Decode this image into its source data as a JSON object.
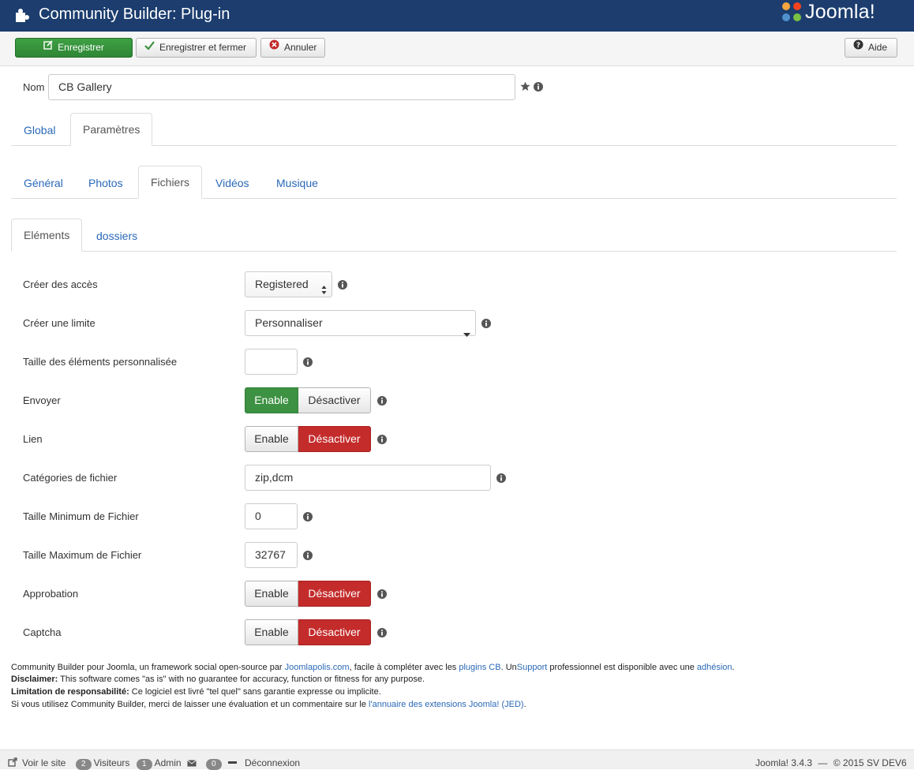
{
  "header": {
    "title": "Community Builder: Plug-in",
    "logo_text": "Joomla!"
  },
  "toolbar": {
    "save_label": "Enregistrer",
    "save_close_label": "Enregistrer et fermer",
    "cancel_label": "Annuler",
    "help_label": "Aide"
  },
  "name_field": {
    "label": "Nom",
    "value": "CB Gallery"
  },
  "main_tabs": [
    {
      "label": "Global",
      "active": false
    },
    {
      "label": "Paramètres",
      "active": true
    }
  ],
  "sub_tabs": [
    {
      "label": "Général",
      "active": false
    },
    {
      "label": "Photos",
      "active": false
    },
    {
      "label": "Fichiers",
      "active": true
    },
    {
      "label": "Vidéos",
      "active": false
    },
    {
      "label": "Musique",
      "active": false
    }
  ],
  "inner_tabs": [
    {
      "label": "Eléments",
      "active": true
    },
    {
      "label": "dossiers",
      "active": false
    }
  ],
  "fields": {
    "create_access": {
      "label": "Créer des accès",
      "value": "Registered"
    },
    "create_limit": {
      "label": "Créer une limite",
      "value": "Personnaliser"
    },
    "custom_size": {
      "label": "Taille des éléments personnalisée",
      "value": ""
    },
    "send": {
      "label": "Envoyer",
      "enable": "Enable",
      "disable": "Désactiver",
      "state": "enable"
    },
    "link": {
      "label": "Lien",
      "enable": "Enable",
      "disable": "Désactiver",
      "state": "disable"
    },
    "file_categories": {
      "label": "Catégories de fichier",
      "value": "zip,dcm"
    },
    "min_size": {
      "label": "Taille Minimum de Fichier",
      "value": "0"
    },
    "max_size": {
      "label": "Taille Maximum de Fichier",
      "value": "32767"
    },
    "approval": {
      "label": "Approbation",
      "enable": "Enable",
      "disable": "Désactiver",
      "state": "disable"
    },
    "captcha": {
      "label": "Captcha",
      "enable": "Enable",
      "disable": "Désactiver",
      "state": "disable"
    }
  },
  "footer": {
    "line1_a": "Community Builder pour Joomla, un framework social open-source par ",
    "line1_link1": "Joomlapolis.com",
    "line1_b": ", facile à compléter avec les ",
    "line1_link2": "plugins CB",
    "line1_c": ". Un",
    "line1_link3": "Support",
    "line1_d": " professionnel est disponible avec une ",
    "line1_link4": "adhésion",
    "line1_e": ".",
    "line2_bold": "Disclaimer:",
    "line2_text": " This software comes \"as is\" with no guarantee for accuracy, function or fitness for any purpose.",
    "line3_bold": "Limitation de responsabilité:",
    "line3_text": " Ce logiciel est livré \"tel quel\" sans garantie expresse ou implicite.",
    "line4_text": "Si vous utilisez Community Builder, merci de laisser une évaluation et un commentaire sur le ",
    "line4_link": "l'annuaire des extensions Joomla! (JED)",
    "line4_end": "."
  },
  "statusbar": {
    "view_site": "Voir le site",
    "visitors_count": "2",
    "visitors_label": "Visiteurs",
    "admin_count": "1",
    "admin_label": "Admin",
    "messages_count": "0",
    "logout_label": "Déconnexion",
    "version": "Joomla! 3.4.3",
    "separator": "—",
    "copyright": "© 2015 SV DEV6"
  },
  "colors": {
    "header_bg": "#1c3d6e",
    "save_green": "#3d9142",
    "disable_red": "#c42b2b",
    "link_blue": "#2a69b8"
  }
}
